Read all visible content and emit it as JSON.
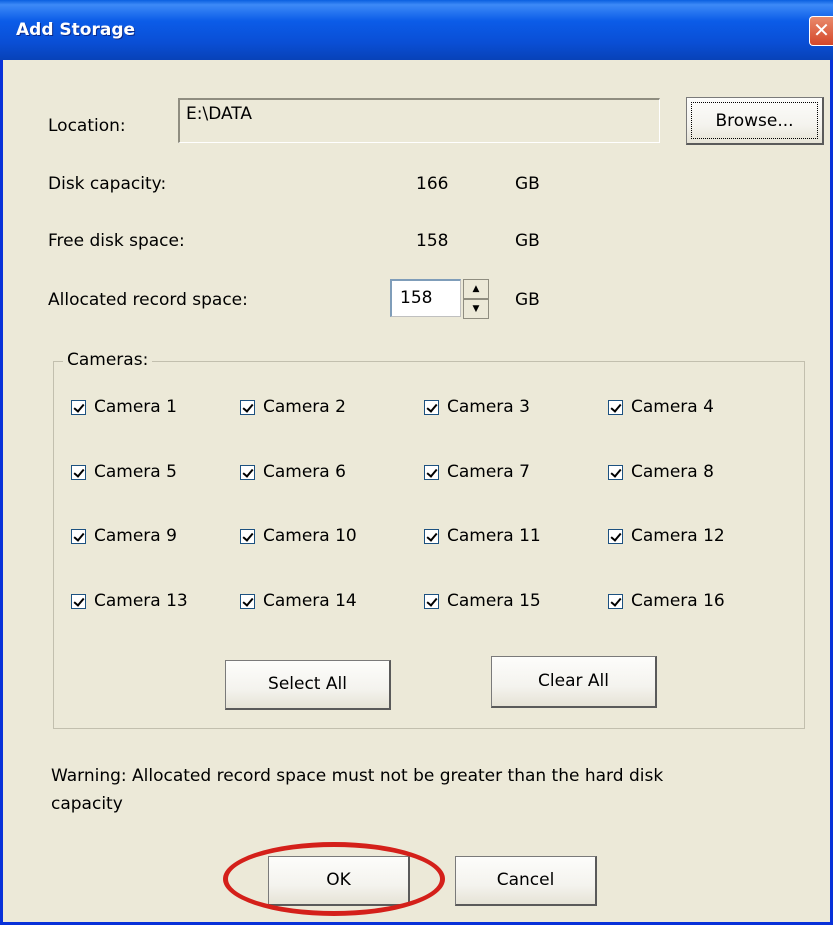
{
  "window": {
    "title": "Add Storage"
  },
  "location": {
    "label": "Location:",
    "value": "E:\\DATA",
    "browse_label": "Browse..."
  },
  "disk_capacity": {
    "label": "Disk capacity:",
    "value": "166",
    "unit": "GB"
  },
  "free_space": {
    "label": "Free disk space:",
    "value": "158",
    "unit": "GB"
  },
  "allocated": {
    "label": "Allocated record space:",
    "value": "158",
    "unit": "GB"
  },
  "cameras": {
    "legend": "Cameras:",
    "items": [
      {
        "label": "Camera 1",
        "checked": true
      },
      {
        "label": "Camera 2",
        "checked": true
      },
      {
        "label": "Camera 3",
        "checked": true
      },
      {
        "label": "Camera 4",
        "checked": true
      },
      {
        "label": "Camera 5",
        "checked": true
      },
      {
        "label": "Camera 6",
        "checked": true
      },
      {
        "label": "Camera 7",
        "checked": true
      },
      {
        "label": "Camera 8",
        "checked": true
      },
      {
        "label": "Camera 9",
        "checked": true
      },
      {
        "label": "Camera 10",
        "checked": true
      },
      {
        "label": "Camera 11",
        "checked": true
      },
      {
        "label": "Camera 12",
        "checked": true
      },
      {
        "label": "Camera 13",
        "checked": true
      },
      {
        "label": "Camera 14",
        "checked": true
      },
      {
        "label": "Camera 15",
        "checked": true
      },
      {
        "label": "Camera 16",
        "checked": true
      }
    ],
    "select_all_label": "Select All",
    "clear_all_label": "Clear All"
  },
  "warning": {
    "line1": "Warning: Allocated record space must not be greater than the hard disk",
    "line2": "capacity"
  },
  "buttons": {
    "ok_label": "OK",
    "cancel_label": "Cancel"
  },
  "colors": {
    "title_bar": "#0a4fd6",
    "dialog_bg": "#ece9d8",
    "highlight_ellipse": "#d4201a",
    "close_button": "#d4472a"
  }
}
